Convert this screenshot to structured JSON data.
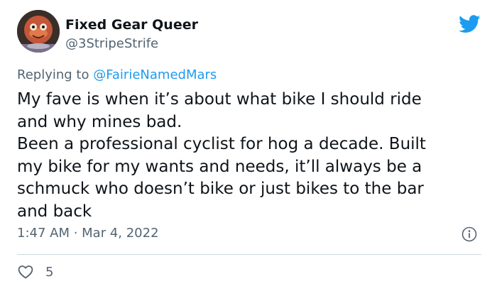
{
  "author": {
    "display_name": "Fixed Gear Queer",
    "handle": "@3StripeStrife",
    "avatar_icon": "avatar-image"
  },
  "reply": {
    "prefix": "Replying to ",
    "mention": "@FairieNamedMars"
  },
  "body_lines": [
    "My fave is when it’s about what bike I should ride",
    "and why mines bad.",
    "Been a professional cyclist for hog a decade. Built",
    "my bike for my wants and needs, it’ll always be a",
    "schmuck who doesn’t bike or just bikes to the bar",
    "and back"
  ],
  "timestamp": "1:47 AM · Mar 4, 2022",
  "likes": {
    "count": "5",
    "icon": "heart-icon"
  },
  "icons": {
    "brand": "twitter-bird-icon",
    "info": "info-icon"
  },
  "colors": {
    "brand_blue": "#1d9bf0",
    "text_primary": "#0f1419",
    "text_secondary": "#536471",
    "divider": "#cfd9de"
  }
}
